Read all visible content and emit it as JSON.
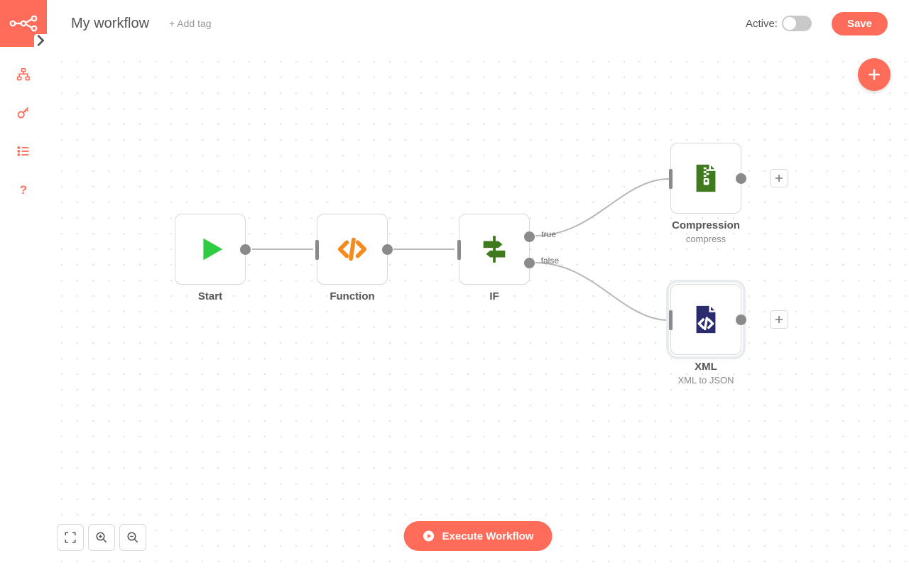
{
  "header": {
    "workflow_name": "My workflow",
    "add_tag": "+ Add tag",
    "active_label": "Active:",
    "save": "Save"
  },
  "canvas": {
    "execute": "Execute Workflow"
  },
  "nodes": {
    "start": {
      "title": "Start"
    },
    "function": {
      "title": "Function"
    },
    "if": {
      "title": "IF",
      "true_label": "true",
      "false_label": "false"
    },
    "compression": {
      "title": "Compression",
      "subtitle": "compress"
    },
    "xml": {
      "title": "XML",
      "subtitle": "XML to JSON"
    }
  },
  "icons": {
    "start": "play",
    "function": "code-brackets",
    "if": "signpost",
    "compression": "zip-file",
    "xml": "code-file"
  },
  "colors": {
    "accent": "#ff6d5a",
    "start_icon": "#2ecc40",
    "function_icon": "#f58a1f",
    "if_icon": "#3f7a1f",
    "compression_icon": "#3f7a1f",
    "xml_icon": "#2a2a6e"
  }
}
